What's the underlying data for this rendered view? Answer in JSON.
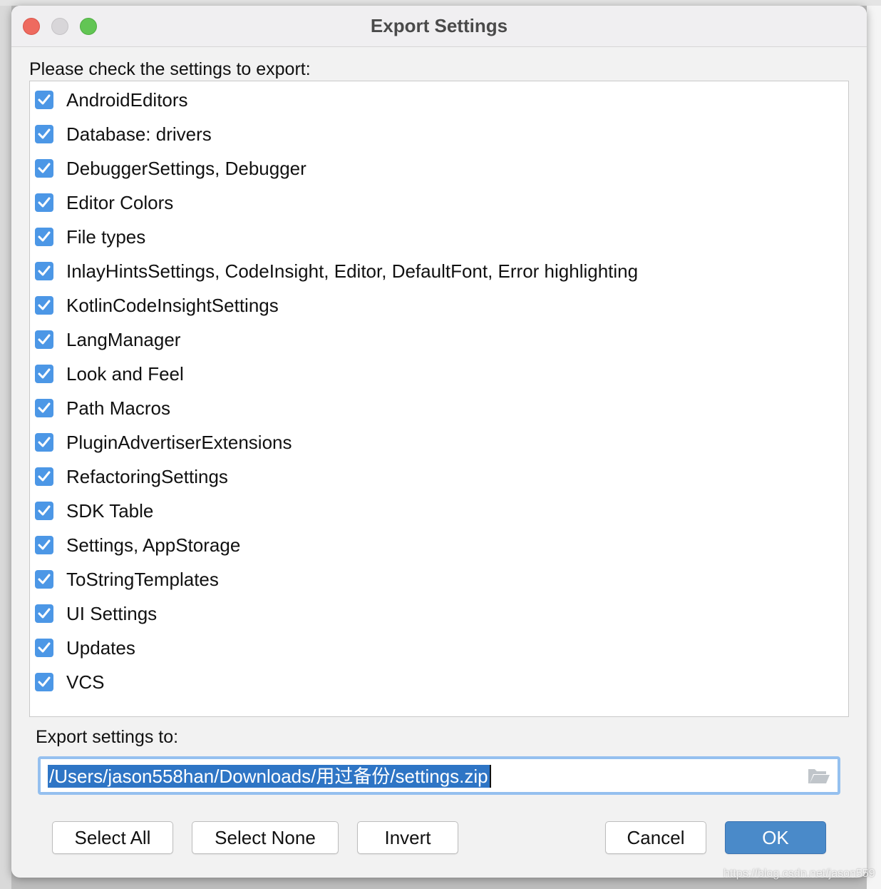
{
  "dialog": {
    "title": "Export Settings",
    "instruction": "Please check the settings to export:",
    "export_label": "Export settings to:",
    "path_value": "/Users/jason558han/Downloads/用过备份/settings.zip"
  },
  "items": [
    {
      "label": "AndroidEditors",
      "checked": true
    },
    {
      "label": "Database: drivers",
      "checked": true
    },
    {
      "label": "DebuggerSettings, Debugger",
      "checked": true
    },
    {
      "label": "Editor Colors",
      "checked": true
    },
    {
      "label": "File types",
      "checked": true
    },
    {
      "label": "InlayHintsSettings, CodeInsight, Editor, DefaultFont, Error highlighting",
      "checked": true
    },
    {
      "label": "KotlinCodeInsightSettings",
      "checked": true
    },
    {
      "label": "LangManager",
      "checked": true
    },
    {
      "label": "Look and Feel",
      "checked": true
    },
    {
      "label": "Path Macros",
      "checked": true
    },
    {
      "label": "PluginAdvertiserExtensions",
      "checked": true
    },
    {
      "label": "RefactoringSettings",
      "checked": true
    },
    {
      "label": "SDK Table",
      "checked": true
    },
    {
      "label": "Settings, AppStorage",
      "checked": true
    },
    {
      "label": "ToStringTemplates",
      "checked": true
    },
    {
      "label": "UI Settings",
      "checked": true
    },
    {
      "label": "Updates",
      "checked": true
    },
    {
      "label": "VCS",
      "checked": true
    }
  ],
  "buttons": {
    "select_all": "Select All",
    "select_none": "Select None",
    "invert": "Invert",
    "cancel": "Cancel",
    "ok": "OK"
  },
  "watermark": "https://blog.csdn.net/jason559",
  "colors": {
    "accent": "#4a8ac9",
    "checkbox": "#4c97e6",
    "selection": "#2e75c5"
  }
}
